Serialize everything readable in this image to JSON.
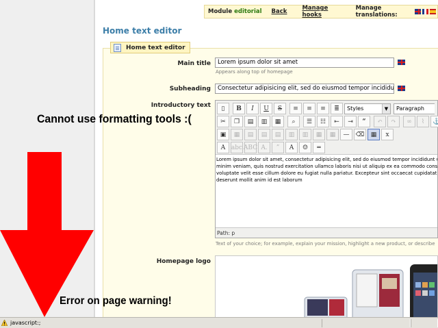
{
  "module_bar": {
    "module_label": "Module",
    "module_name": "editorial",
    "back": "Back",
    "manage_hooks": "Manage hooks",
    "manage_translations": "Manage translations:",
    "flags": [
      "flag-uk-icon",
      "flag-fr-icon",
      "flag-es-icon"
    ]
  },
  "page_title": "Home text editor",
  "legend": "Home text editor",
  "fields": {
    "main_title": {
      "label": "Main title",
      "value": "Lorem ipsum dolor sit amet",
      "hint": "Appears along top of homepage"
    },
    "subheading": {
      "label": "Subheading",
      "value": "Consectetur adipisicing elit, sed do eiusmod tempor incididunt ut"
    },
    "intro": {
      "label": "Introductory text",
      "styles_select": "Styles",
      "format_select": "Paragraph",
      "content_lines": [
        "Lorem ipsum dolor sit amet, consectetur adipisicing elit, sed do eiusmod tempor incididunt ut",
        "minim veniam, quis nostrud exercitation ullamco laboris nisi ut aliquip ex ea commodo consec",
        "voluptate velit esse cillum dolore eu fugiat nulla pariatur. Excepteur sint occaecat cupidatat n",
        "deserunt mollit anim id est laborum"
      ],
      "path": "Path: p",
      "hint": "Text of your choice; for example, explain your mission, highlight a new product, or describe"
    },
    "logo": {
      "label": "Homepage logo"
    }
  },
  "annotations": {
    "formatting": "Cannot use formatting tools :(",
    "error": "Error on page warning!"
  },
  "status_bar": {
    "text": "javascript:;"
  },
  "colors": {
    "title_blue": "#3c7ea8",
    "module_green": "#2d7a0f",
    "fieldset_bg": "#fffde9",
    "arrow_red": "#ff0000"
  }
}
